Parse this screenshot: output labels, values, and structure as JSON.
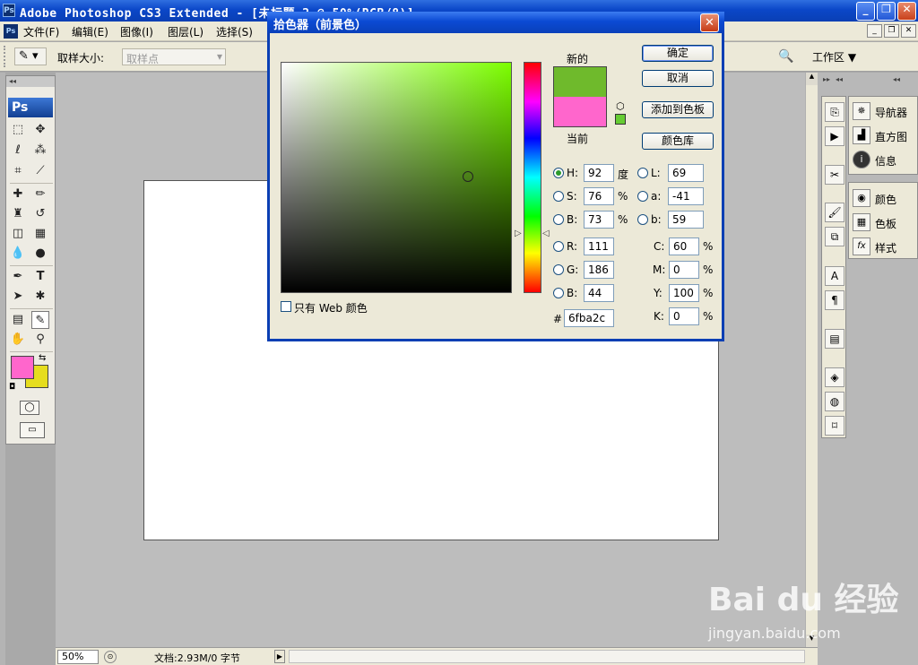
{
  "window": {
    "title": "Adobe Photoshop CS3 Extended - [未标题-2 @ 50%(RGB/8)]",
    "app_badge": "Ps"
  },
  "menu": {
    "items": [
      "文件(F)",
      "编辑(E)",
      "图像(I)",
      "图层(L)",
      "选择(S)"
    ],
    "workspace_label": "工作区",
    "workspace_arrow": "▼"
  },
  "options": {
    "sample_size_label": "取样大小:",
    "sample_size_value": "取样点"
  },
  "toolbox": {
    "ps_label": "Ps",
    "foreground_color": "#ff66cc",
    "background_color": "#e6dd1e"
  },
  "status": {
    "zoom": "50%",
    "doc_info": "文档:2.93M/0 字节"
  },
  "panels": {
    "group1": [
      "导航器",
      "直方图",
      "信息"
    ],
    "group2": [
      "颜色",
      "色板",
      "样式"
    ]
  },
  "dialog": {
    "title": "拾色器（前景色）",
    "new_label": "新的",
    "current_label": "当前",
    "new_color": "#6fba2c",
    "current_color": "#ff66cc",
    "buttons": {
      "ok": "确定",
      "cancel": "取消",
      "add_swatch": "添加到色板",
      "color_libraries": "颜色库"
    },
    "web_only_label": "只有 Web 颜色",
    "hsb": {
      "h_label": "H:",
      "h": "92",
      "h_unit": "度",
      "s_label": "S:",
      "s": "76",
      "s_unit": "%",
      "b_label": "B:",
      "b": "73",
      "b_unit": "%"
    },
    "rgb": {
      "r_label": "R:",
      "r": "111",
      "g_label": "G:",
      "g": "186",
      "b_label": "B:",
      "b": "44"
    },
    "lab": {
      "l_label": "L:",
      "l": "69",
      "a_label": "a:",
      "a": "-41",
      "b_label": "b:",
      "b": "59"
    },
    "cmyk": {
      "c_label": "C:",
      "c": "60",
      "m_label": "M:",
      "m": "0",
      "y_label": "Y:",
      "y": "100",
      "k_label": "K:",
      "k": "0",
      "unit": "%"
    },
    "hex_label": "#",
    "hex": "6fba2c"
  },
  "watermark": {
    "logo": "Bai du 经验",
    "url": "jingyan.baidu.com"
  }
}
